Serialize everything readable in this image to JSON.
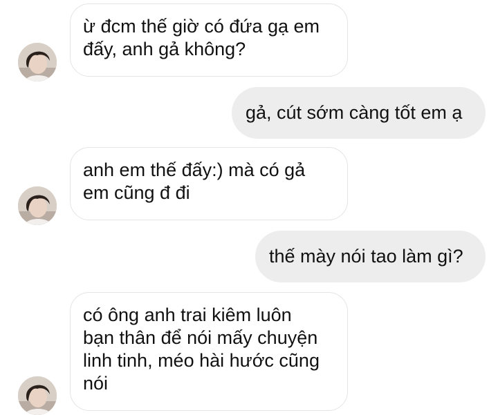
{
  "conversation": {
    "messages": [
      {
        "direction": "incoming",
        "lines": [
          "ừ đcm thế giờ có đứa gạ em",
          "đấy, anh gả không?"
        ]
      },
      {
        "direction": "outgoing",
        "lines": [
          "gả, cút sớm càng tốt em ạ"
        ]
      },
      {
        "direction": "incoming",
        "lines": [
          "anh em thế đấy:) mà có gả",
          "em cũng đ đi"
        ]
      },
      {
        "direction": "outgoing",
        "lines": [
          "thế mày nói tao làm gì?"
        ]
      },
      {
        "direction": "incoming",
        "lines": [
          "có ông anh trai kiêm luôn",
          "bạn thân để nói mấy chuyện",
          "linh tinh, méo hài hước cũng",
          "nói"
        ]
      }
    ]
  },
  "colors": {
    "incoming_bubble_bg": "#ffffff",
    "incoming_bubble_border": "#e4e4e4",
    "outgoing_bubble_bg": "#ededed",
    "text": "#111111"
  },
  "icons": {
    "avatar": "contact-avatar-photo"
  }
}
